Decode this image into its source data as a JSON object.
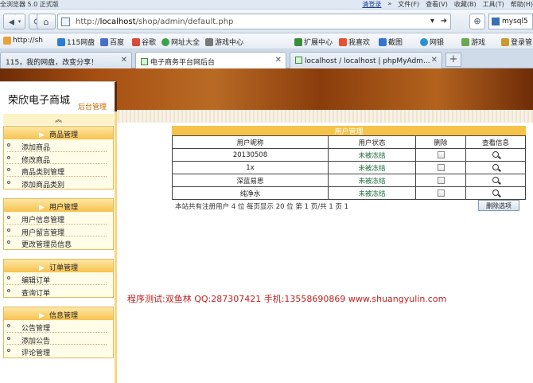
{
  "browser": {
    "window_title": "全浏览器 5.0 正式版",
    "menu": [
      "清登录",
      "»",
      "文件(F)",
      "查看(V)",
      "收藏(B)",
      "工具(T)",
      "帮助(H)"
    ],
    "address_prefix": "http://",
    "address_host": "localhost",
    "address_path": "/shop/admin/default.php",
    "search_text": "mysql5",
    "favorites": [
      "http://sh",
      "115网盘",
      "百度",
      "谷歌",
      "网址大全",
      "游戏中心",
      "扩展中心",
      "我喜欢",
      "截图",
      "网银",
      "游戏",
      "登录管"
    ],
    "tabs": [
      {
        "label": "115，我的网盘，改变分享！",
        "active": false
      },
      {
        "label": "电子商务平台网后台",
        "active": true
      },
      {
        "label": "localhost / localhost | phpMyAdm...",
        "active": false
      }
    ]
  },
  "site": {
    "logo": "荣欣电子商城",
    "logo_sub": "后台管理"
  },
  "sidebar": {
    "collapse_symbol": "^",
    "groups": [
      {
        "title": "商品管理",
        "items": [
          "添加商品",
          "修改商品",
          "商品类别管理",
          "添加商品类别"
        ]
      },
      {
        "title": "用户管理",
        "items": [
          "用户信息管理",
          "用户留言管理",
          "更改管理员信息"
        ]
      },
      {
        "title": "订单管理",
        "items": [
          "编辑订单",
          "查询订单"
        ]
      },
      {
        "title": "信息管理",
        "items": [
          "公告管理",
          "添加公告",
          "评论管理"
        ]
      }
    ]
  },
  "content": {
    "title": "用户管理",
    "headers": [
      "用户昵称",
      "用户状态",
      "删除",
      "查看信息"
    ],
    "rows": [
      {
        "nick": "20130508",
        "status": "未被冻结"
      },
      {
        "nick": "1x",
        "status": "未被冻结"
      },
      {
        "nick": "深蓝易思",
        "status": "未被冻结"
      },
      {
        "nick": "纯净水",
        "status": "未被冻结"
      }
    ],
    "footer": "本站共有注册用户 4 位  每页显示 20 位  第 1 页/共 1 页 1",
    "delete_button": "删除选项",
    "credit": "程序测试:双鱼林 QQ:287307421 手机:13558690869 www.shuangyulin.com"
  }
}
